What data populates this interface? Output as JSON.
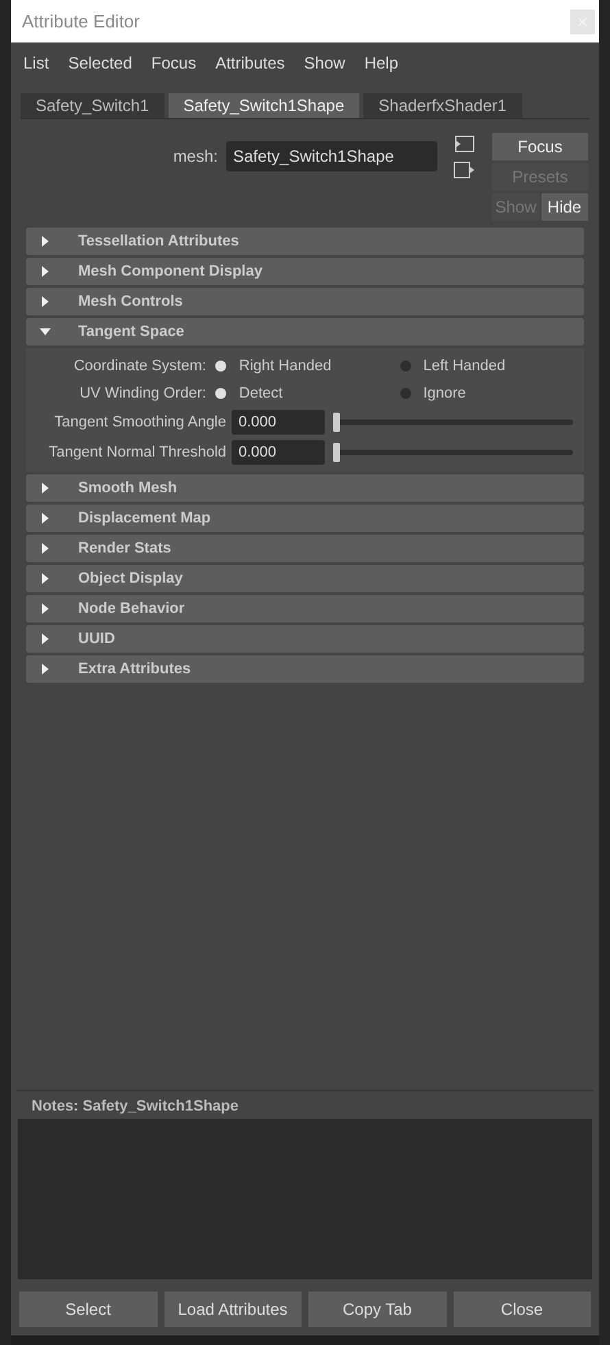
{
  "window": {
    "title": "Attribute Editor"
  },
  "menu": [
    "List",
    "Selected",
    "Focus",
    "Attributes",
    "Show",
    "Help"
  ],
  "tabs": [
    {
      "label": "Safety_Switch1",
      "selected": false
    },
    {
      "label": "Safety_Switch1Shape",
      "selected": true
    },
    {
      "label": "ShaderfxShader1",
      "selected": false
    }
  ],
  "node_field": {
    "label": "mesh:",
    "value": "Safety_Switch1Shape"
  },
  "side_buttons": [
    {
      "label": "Focus",
      "disabled": false
    },
    {
      "label": "Presets",
      "disabled": true
    }
  ],
  "show_hide": [
    {
      "label": "Show",
      "selected": false
    },
    {
      "label": "Hide",
      "selected": true
    }
  ],
  "sections": [
    {
      "title": "Tessellation Attributes",
      "expanded": false
    },
    {
      "title": "Mesh Component Display",
      "expanded": false
    },
    {
      "title": "Mesh Controls",
      "expanded": false
    },
    {
      "title": "Tangent Space",
      "expanded": true,
      "rows": [
        {
          "kind": "radio",
          "label": "Coordinate System:",
          "options": [
            {
              "label": "Right Handed",
              "selected": true
            },
            {
              "label": "Left Handed",
              "selected": false
            }
          ]
        },
        {
          "kind": "radio",
          "label": "UV Winding Order:",
          "options": [
            {
              "label": "Detect",
              "selected": true
            },
            {
              "label": "Ignore",
              "selected": false
            }
          ]
        },
        {
          "kind": "slider",
          "label": "Tangent Smoothing Angle",
          "value": "0.000",
          "level": 0
        },
        {
          "kind": "slider",
          "label": "Tangent Normal Threshold",
          "value": "0.000",
          "level": 0
        }
      ]
    },
    {
      "title": "Smooth Mesh",
      "expanded": false
    },
    {
      "title": "Displacement Map",
      "expanded": false
    },
    {
      "title": "Render Stats",
      "expanded": false
    },
    {
      "title": "Object Display",
      "expanded": false
    },
    {
      "title": "Node Behavior",
      "expanded": false
    },
    {
      "title": "UUID",
      "expanded": false
    },
    {
      "title": "Extra Attributes",
      "expanded": false
    }
  ],
  "notes": {
    "label": "Notes:  Safety_Switch1Shape"
  },
  "buttons": [
    "Select",
    "Load Attributes",
    "Copy Tab",
    "Close"
  ]
}
